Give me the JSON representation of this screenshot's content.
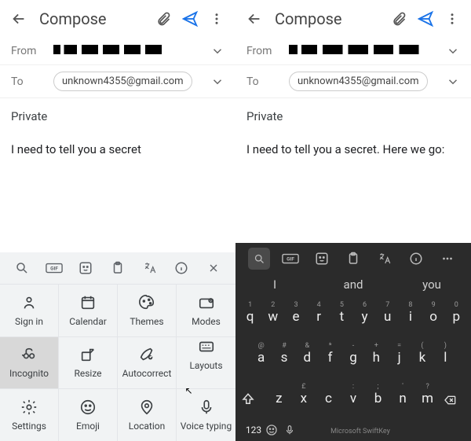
{
  "left": {
    "topbar": {
      "title": "Compose"
    },
    "from": {
      "label": "From"
    },
    "to": {
      "label": "To",
      "chip": "unknown4355@gmail.com"
    },
    "subject": "Private",
    "body": "I need to tell you a secret",
    "kb_cells": [
      {
        "label": "Sign in"
      },
      {
        "label": "Calendar"
      },
      {
        "label": "Themes"
      },
      {
        "label": "Modes"
      },
      {
        "label": "Incognito",
        "selected": true
      },
      {
        "label": "Resize"
      },
      {
        "label": "Autocorrect"
      },
      {
        "label": "Layouts"
      },
      {
        "label": "Settings"
      },
      {
        "label": "Emoji"
      },
      {
        "label": "Location"
      },
      {
        "label": "Voice typing"
      }
    ]
  },
  "right": {
    "topbar": {
      "title": "Compose"
    },
    "from": {
      "label": "From"
    },
    "to": {
      "label": "To",
      "chip": "unknown4355@gmail.com"
    },
    "subject": "Private",
    "body": "I need to tell you a secret. Here we go:",
    "suggestions": [
      "I",
      "and",
      "you"
    ],
    "row1": [
      {
        "k": "q",
        "h": "1"
      },
      {
        "k": "w",
        "h": "2"
      },
      {
        "k": "e",
        "h": "3"
      },
      {
        "k": "r",
        "h": "4"
      },
      {
        "k": "t",
        "h": "5"
      },
      {
        "k": "y",
        "h": "6"
      },
      {
        "k": "u",
        "h": "7"
      },
      {
        "k": "i",
        "h": "8"
      },
      {
        "k": "o",
        "h": "9"
      },
      {
        "k": "p",
        "h": "0"
      }
    ],
    "row2": [
      {
        "k": "a",
        "h": "@"
      },
      {
        "k": "s",
        "h": "#"
      },
      {
        "k": "d",
        "h": "&"
      },
      {
        "k": "f",
        "h": "*"
      },
      {
        "k": "g",
        "h": "-"
      },
      {
        "k": "h",
        "h": "+"
      },
      {
        "k": "j",
        "h": "="
      },
      {
        "k": "k",
        "h": "("
      },
      {
        "k": "l",
        "h": ")"
      }
    ],
    "row3": [
      {
        "k": "z",
        "h": ""
      },
      {
        "k": "x",
        "h": "£"
      },
      {
        "k": "c",
        "h": ""
      },
      {
        "k": "v",
        "h": ":"
      },
      {
        "k": "b",
        "h": ";"
      },
      {
        "k": "n",
        "h": "'"
      },
      {
        "k": "m",
        "h": "?"
      }
    ],
    "sym_key": "123",
    "brand": "Microsoft SwiftKey"
  }
}
